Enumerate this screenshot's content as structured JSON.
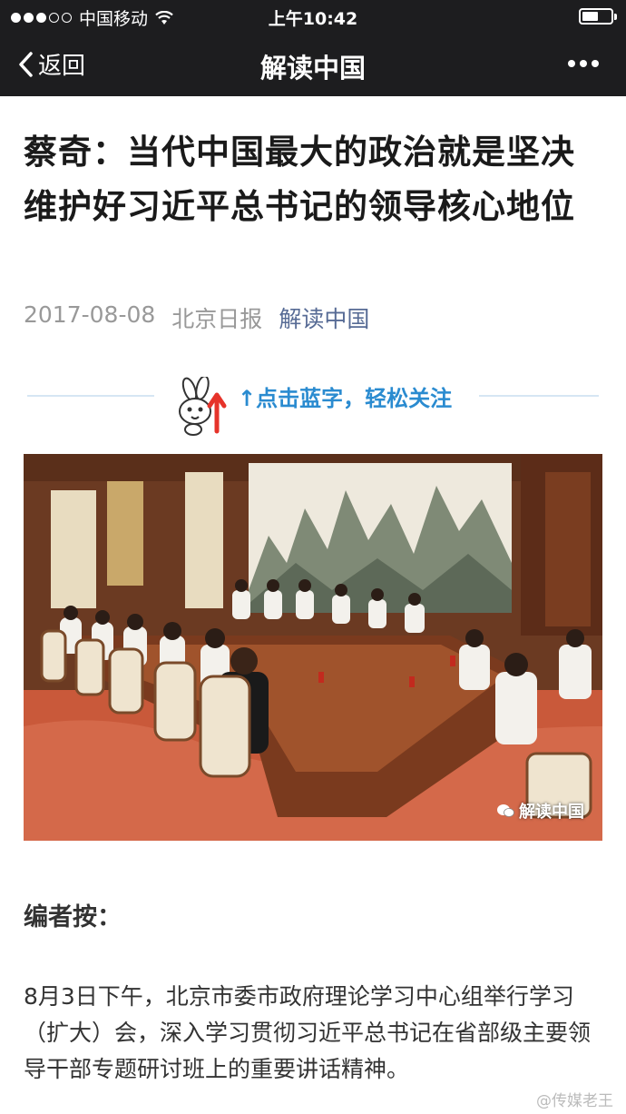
{
  "status_bar": {
    "carrier": "中国移动",
    "time": "上午10:42",
    "battery_level": 0.55
  },
  "nav": {
    "back_label": "返回",
    "title": "解读中国"
  },
  "article": {
    "title": "蔡奇：当代中国最大的政治就是坚决维护好习近平总书记的领导核心地位",
    "date": "2017-08-08",
    "source": "北京日报",
    "account": "解读中国",
    "follow_text": "↑点击蓝字，轻松关注",
    "photo_watermark": "解读中国",
    "editor_heading": "编者按：",
    "body": "8月3日下午，北京市委市政府理论学习中心组举行学习（扩大）会，深入学习贯彻习近平总书记在省部级主要领导干部专题研讨班上的重要讲话精神。"
  },
  "corner_watermark": "@传媒老王",
  "colors": {
    "nav_bg": "#1d1d1f",
    "account_link": "#576b95",
    "follow_blue": "#2a8bd0"
  }
}
